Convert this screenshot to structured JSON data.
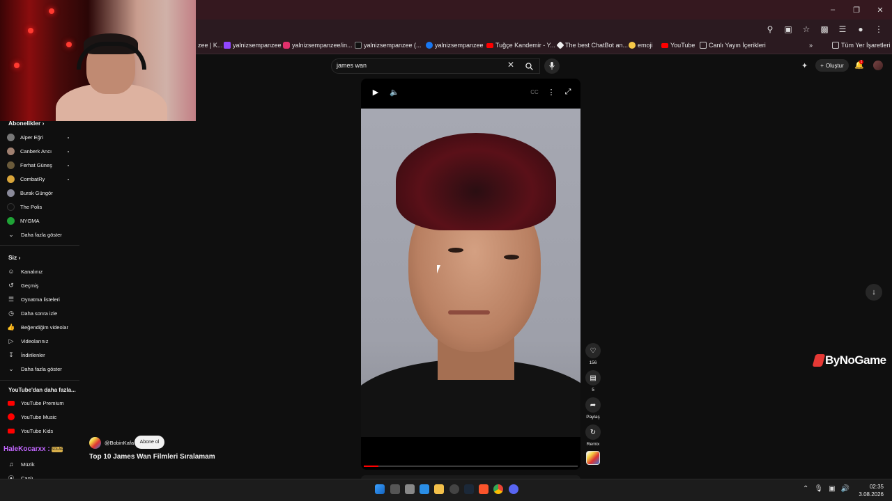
{
  "browser": {
    "bookmarks": [
      {
        "label": "zee | K..."
      },
      {
        "label": "yalnizsempanzee"
      },
      {
        "label": "yalnizsempanzee/in..."
      },
      {
        "label": "yalnizsempanzee (..."
      },
      {
        "label": "yalnizsempanzee"
      },
      {
        "label": "Tuğçe Kandemir - Y..."
      },
      {
        "label": "The best ChatBot an..."
      },
      {
        "label": "emoji"
      },
      {
        "label": "YouTube"
      },
      {
        "label": "Canlı Yayın İçerikleri"
      },
      {
        "label": "Tüm Yer İşaretleri"
      }
    ]
  },
  "header": {
    "search_value": "james wan",
    "create_label": "Oluştur",
    "notif_count": "1"
  },
  "sidebar": {
    "subscriptions_title": "Abonelikler",
    "subscriptions": [
      {
        "label": "Alper Eğri"
      },
      {
        "label": "Canberk Ancı"
      },
      {
        "label": "Ferhat Güneş"
      },
      {
        "label": "CombatRy"
      },
      {
        "label": "Burak Güngör"
      },
      {
        "label": "The Polis"
      },
      {
        "label": "NYGMA"
      },
      {
        "label": "Daha fazla göster"
      }
    ],
    "you_title": "Siz",
    "you_items": [
      {
        "label": "Kanalınız"
      },
      {
        "label": "Geçmiş"
      },
      {
        "label": "Oynatma listeleri"
      },
      {
        "label": "Daha sonra izle"
      },
      {
        "label": "Beğendiğim videolar"
      },
      {
        "label": "Videolarınız"
      },
      {
        "label": "İndirilenler"
      },
      {
        "label": "Daha fazla göster"
      }
    ],
    "more_title": "YouTube'dan daha fazla...",
    "more_items": [
      {
        "label": "YouTube Premium"
      },
      {
        "label": "YouTube Music"
      },
      {
        "label": "YouTube Kids"
      }
    ],
    "explore_items": [
      {
        "label": "Müzik"
      },
      {
        "label": "Canlı"
      }
    ]
  },
  "video": {
    "channel": "@BobinKafa",
    "subscribe_label": "Abone ol",
    "title": "Top 10 James Wan Filmleri Sıralamam",
    "likes": "156",
    "comments": "5",
    "share_label": "Paylaş",
    "remix_label": "Remix",
    "progress": 0.07
  },
  "watermark": "ByNoGame",
  "chat": {
    "user": "HaleKocarxx :",
    "badge": "SOLAR"
  },
  "taskbar": {
    "time": "02:35",
    "date": "3.08.2026"
  },
  "colors": {
    "accent": "#ff0000",
    "background": "#0f0f0f",
    "chat_user": "#c266ff"
  }
}
